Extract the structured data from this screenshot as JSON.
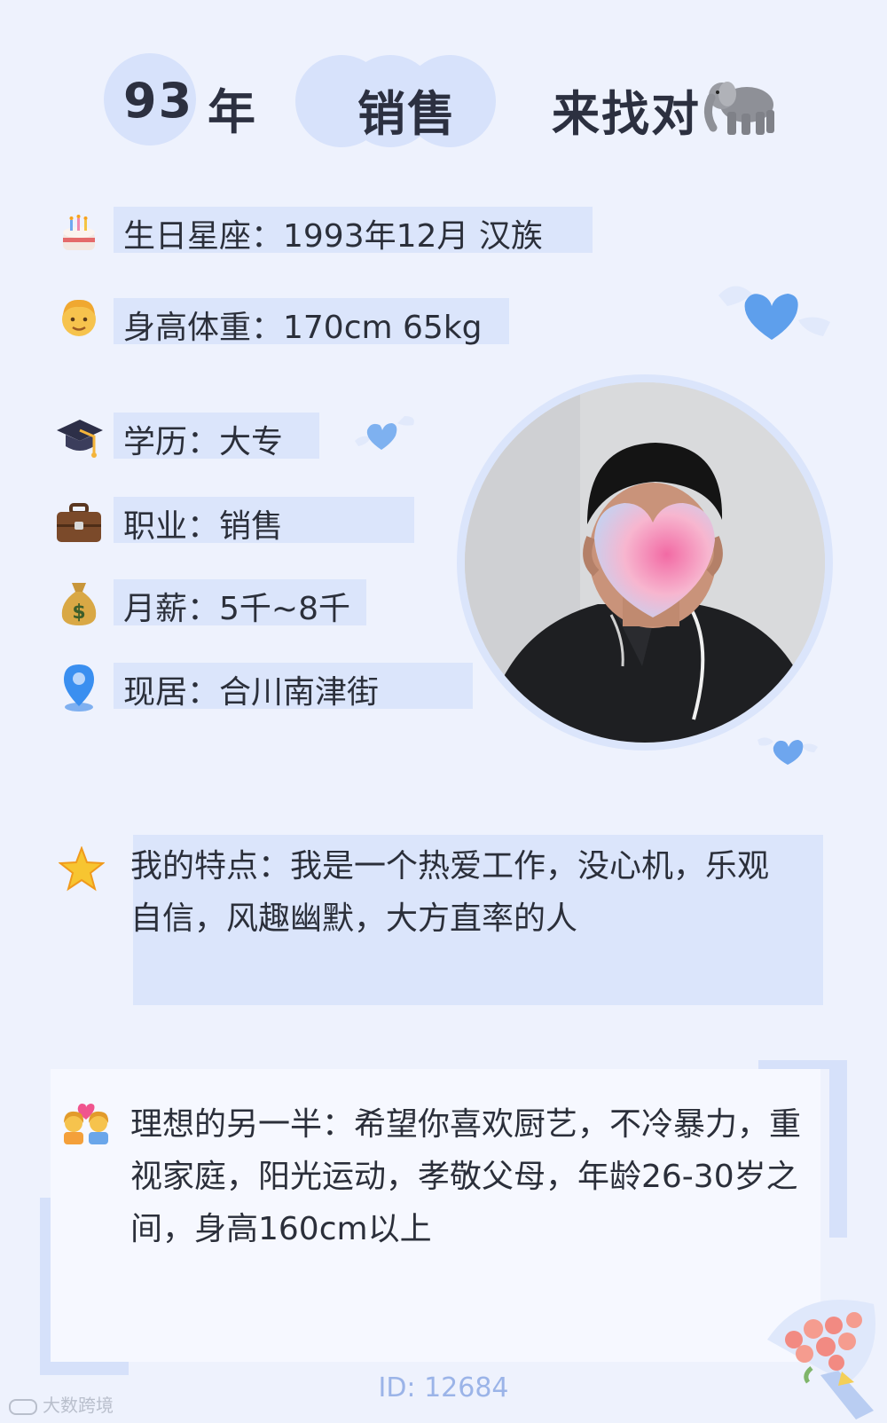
{
  "header": {
    "year": "93",
    "year_suffix": "年",
    "job": "销售",
    "seeking": "来找对",
    "seeking_icon": "elephant-icon"
  },
  "info": [
    {
      "icon": "birthday-cake-icon",
      "text": "生日星座：1993年12月 汉族"
    },
    {
      "icon": "man-face-icon",
      "text": "身高体重：170cm 65kg"
    },
    {
      "icon": "graduation-cap-icon",
      "text": "学历：大专"
    },
    {
      "icon": "briefcase-icon",
      "text": "职业：销售"
    },
    {
      "icon": "money-bag-icon",
      "text": "月薪：5千~8千"
    },
    {
      "icon": "location-pin-icon",
      "text": "现居：合川南津街"
    }
  ],
  "features": {
    "icon": "star-icon",
    "text": "我的特点：我是一个热爱工作，没心机，乐观自信，风趣幽默，大方直率的人"
  },
  "ideal": {
    "icon": "couple-heart-icon",
    "text": "理想的另一半：希望你喜欢厨艺，不冷暴力，重视家庭，阳光运动，孝敬父母，年龄26-30岁之间，身高160cm以上"
  },
  "footer": {
    "id": "ID: 12684",
    "watermark": "大数跨境"
  },
  "colors": {
    "background": "#eef2fd",
    "highlight": "#dbe5fb",
    "accent": "#5b9be8",
    "id_text": "#9bb4e8"
  }
}
